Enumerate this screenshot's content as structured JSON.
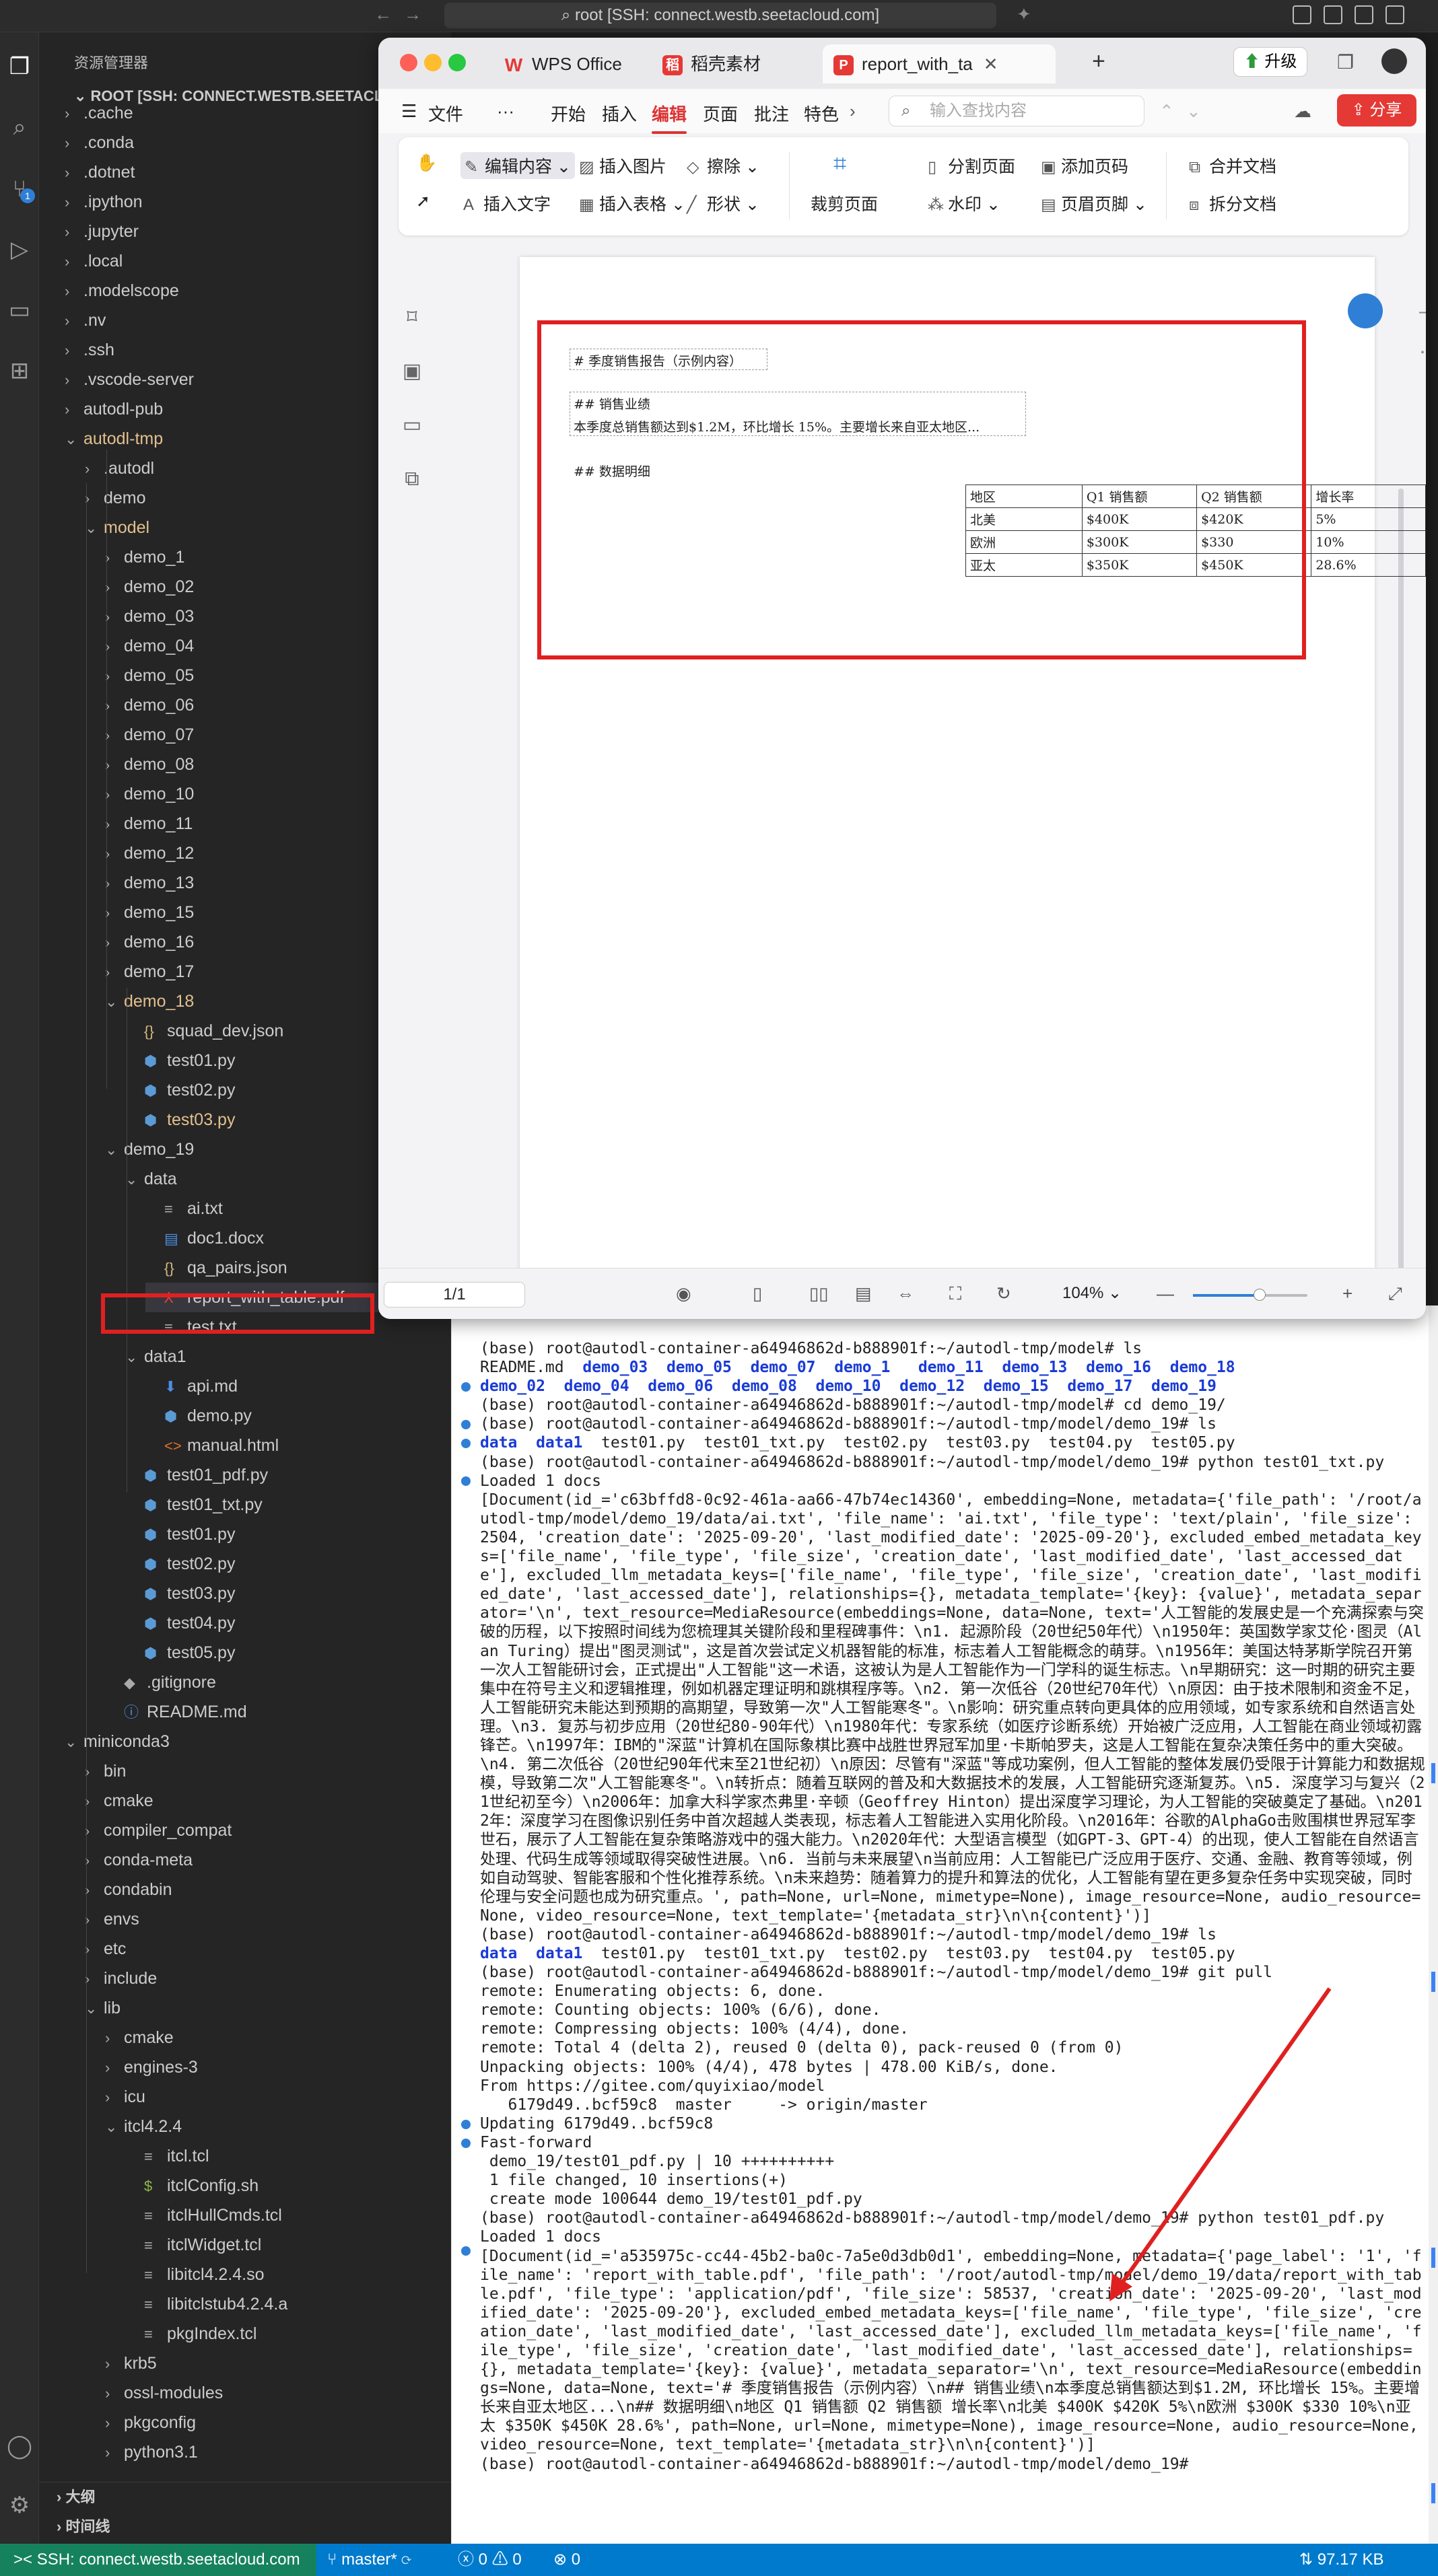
{
  "titlebar": {
    "command": "root [SSH: connect.westb.seetacloud.com]"
  },
  "activity": {
    "scm_badge": "1"
  },
  "explorer": {
    "header": "资源管理器",
    "root": "ROOT [SSH: CONNECT.WESTB.SEETACLO...",
    "items": [
      {
        "t": ".cache",
        "d": 0,
        "k": "dir-c"
      },
      {
        "t": ".conda",
        "d": 0,
        "k": "dir-c"
      },
      {
        "t": ".dotnet",
        "d": 0,
        "k": "dir-c"
      },
      {
        "t": ".ipython",
        "d": 0,
        "k": "dir-c"
      },
      {
        "t": ".jupyter",
        "d": 0,
        "k": "dir-c"
      },
      {
        "t": ".local",
        "d": 0,
        "k": "dir-c"
      },
      {
        "t": ".modelscope",
        "d": 0,
        "k": "dir-c"
      },
      {
        "t": ".nv",
        "d": 0,
        "k": "dir-c"
      },
      {
        "t": ".ssh",
        "d": 0,
        "k": "dir-c"
      },
      {
        "t": ".vscode-server",
        "d": 0,
        "k": "dir-c"
      },
      {
        "t": "autodl-pub",
        "d": 0,
        "k": "dir-c"
      },
      {
        "t": "autodl-tmp",
        "d": 0,
        "k": "dir-o",
        "y": true
      },
      {
        "t": ".autodl",
        "d": 1,
        "k": "dir-c"
      },
      {
        "t": "demo",
        "d": 1,
        "k": "dir-c"
      },
      {
        "t": "model",
        "d": 1,
        "k": "dir-o",
        "y": true
      },
      {
        "t": "demo_1",
        "d": 2,
        "k": "dir-c"
      },
      {
        "t": "demo_02",
        "d": 2,
        "k": "dir-c"
      },
      {
        "t": "demo_03",
        "d": 2,
        "k": "dir-c"
      },
      {
        "t": "demo_04",
        "d": 2,
        "k": "dir-c"
      },
      {
        "t": "demo_05",
        "d": 2,
        "k": "dir-c"
      },
      {
        "t": "demo_06",
        "d": 2,
        "k": "dir-c"
      },
      {
        "t": "demo_07",
        "d": 2,
        "k": "dir-c"
      },
      {
        "t": "demo_08",
        "d": 2,
        "k": "dir-c"
      },
      {
        "t": "demo_10",
        "d": 2,
        "k": "dir-c"
      },
      {
        "t": "demo_11",
        "d": 2,
        "k": "dir-c"
      },
      {
        "t": "demo_12",
        "d": 2,
        "k": "dir-c"
      },
      {
        "t": "demo_13",
        "d": 2,
        "k": "dir-c"
      },
      {
        "t": "demo_15",
        "d": 2,
        "k": "dir-c"
      },
      {
        "t": "demo_16",
        "d": 2,
        "k": "dir-c"
      },
      {
        "t": "demo_17",
        "d": 2,
        "k": "dir-c"
      },
      {
        "t": "demo_18",
        "d": 2,
        "k": "dir-o",
        "y": true
      },
      {
        "t": "squad_dev.json",
        "d": 3,
        "k": "json"
      },
      {
        "t": "test01.py",
        "d": 3,
        "k": "py"
      },
      {
        "t": "test02.py",
        "d": 3,
        "k": "py"
      },
      {
        "t": "test03.py",
        "d": 3,
        "k": "py",
        "y": true
      },
      {
        "t": "demo_19",
        "d": 2,
        "k": "dir-o"
      },
      {
        "t": "data",
        "d": 3,
        "k": "dir-o"
      },
      {
        "t": "ai.txt",
        "d": 4,
        "k": "txt"
      },
      {
        "t": "doc1.docx",
        "d": 4,
        "k": "doc"
      },
      {
        "t": "qa_pairs.json",
        "d": 4,
        "k": "json"
      },
      {
        "t": "report_with_table.pdf",
        "d": 4,
        "k": "pdf",
        "sel": true
      },
      {
        "t": "test.txt",
        "d": 4,
        "k": "txt"
      },
      {
        "t": "data1",
        "d": 3,
        "k": "dir-o"
      },
      {
        "t": "api.md",
        "d": 4,
        "k": "md"
      },
      {
        "t": "demo.py",
        "d": 4,
        "k": "py"
      },
      {
        "t": "manual.html",
        "d": 4,
        "k": "html"
      },
      {
        "t": "test01_pdf.py",
        "d": 3,
        "k": "py"
      },
      {
        "t": "test01_txt.py",
        "d": 3,
        "k": "py"
      },
      {
        "t": "test01.py",
        "d": 3,
        "k": "py"
      },
      {
        "t": "test02.py",
        "d": 3,
        "k": "py"
      },
      {
        "t": "test03.py",
        "d": 3,
        "k": "py"
      },
      {
        "t": "test04.py",
        "d": 3,
        "k": "py"
      },
      {
        "t": "test05.py",
        "d": 3,
        "k": "py"
      },
      {
        "t": ".gitignore",
        "d": 2,
        "k": "git"
      },
      {
        "t": "README.md",
        "d": 2,
        "k": "info"
      },
      {
        "t": "miniconda3",
        "d": 0,
        "k": "dir-o"
      },
      {
        "t": "bin",
        "d": 1,
        "k": "dir-c"
      },
      {
        "t": "cmake",
        "d": 1,
        "k": "dir-c"
      },
      {
        "t": "compiler_compat",
        "d": 1,
        "k": "dir-c"
      },
      {
        "t": "conda-meta",
        "d": 1,
        "k": "dir-c"
      },
      {
        "t": "condabin",
        "d": 1,
        "k": "dir-c"
      },
      {
        "t": "envs",
        "d": 1,
        "k": "dir-c"
      },
      {
        "t": "etc",
        "d": 1,
        "k": "dir-c"
      },
      {
        "t": "include",
        "d": 1,
        "k": "dir-c"
      },
      {
        "t": "lib",
        "d": 1,
        "k": "dir-o"
      },
      {
        "t": "cmake",
        "d": 2,
        "k": "dir-c"
      },
      {
        "t": "engines-3",
        "d": 2,
        "k": "dir-c"
      },
      {
        "t": "icu",
        "d": 2,
        "k": "dir-c"
      },
      {
        "t": "itcl4.2.4",
        "d": 2,
        "k": "dir-o"
      },
      {
        "t": "itcl.tcl",
        "d": 3,
        "k": "plain"
      },
      {
        "t": "itclConfig.sh",
        "d": 3,
        "k": "sh"
      },
      {
        "t": "itclHullCmds.tcl",
        "d": 3,
        "k": "plain"
      },
      {
        "t": "itclWidget.tcl",
        "d": 3,
        "k": "plain"
      },
      {
        "t": "libitcl4.2.4.so",
        "d": 3,
        "k": "plain"
      },
      {
        "t": "libitclstub4.2.4.a",
        "d": 3,
        "k": "plain"
      },
      {
        "t": "pkgIndex.tcl",
        "d": 3,
        "k": "plain"
      },
      {
        "t": "krb5",
        "d": 2,
        "k": "dir-c"
      },
      {
        "t": "ossl-modules",
        "d": 2,
        "k": "dir-c"
      },
      {
        "t": "pkgconfig",
        "d": 2,
        "k": "dir-c"
      },
      {
        "t": "python3.1",
        "d": 2,
        "k": "dir-c"
      }
    ]
  },
  "outline": {
    "outline": "大纲",
    "timeline": "时间线"
  },
  "status": {
    "remote": "SSH: connect.westb.seetacloud.com",
    "branch": "master*",
    "errors": "0",
    "warnings": "0",
    "ports": "0",
    "net": "97.17 KB"
  },
  "wps": {
    "tabs": [
      "WPS Office",
      "稻壳素材",
      "report_with_ta"
    ],
    "upgrade": "升级",
    "share": "分享",
    "menu": [
      "文件",
      "···",
      "开始",
      "插入",
      "编辑",
      "页面",
      "批注",
      "特色"
    ],
    "search_placeholder": "输入查找内容",
    "ribbon": {
      "edit_content": "编辑内容",
      "insert_image": "插入图片",
      "erase": "擦除",
      "insert_text": "插入文字",
      "insert_table": "插入表格",
      "shape": "形状",
      "crop_page": "裁剪页面",
      "split_page": "分割页面",
      "watermark": "水印",
      "add_page_no": "添加页码",
      "header_footer": "页眉页脚",
      "merge_doc": "合并文档",
      "split_doc": "拆分文档"
    },
    "page_indicator": "1/1",
    "zoom": "104%"
  },
  "pdf": {
    "h1": "# 季度销售报告（示例内容）",
    "h2a": "## 销售业绩",
    "p1": "本季度总销售额达到$1.2M，环比增长 15%。主要增长来自亚太地区...",
    "h2b": "## 数据明细",
    "table": [
      [
        "地区",
        "Q1 销售额",
        "Q2 销售额",
        "增长率"
      ],
      [
        "北美",
        "$400K",
        "$420K",
        "5%"
      ],
      [
        "欧洲",
        "$300K",
        "$330",
        "10%"
      ],
      [
        "亚太",
        "$350K",
        "$450K",
        "28.6%"
      ]
    ]
  },
  "terminal": {
    "lines": [
      {
        "p": "",
        "t": "(base) root@autodl-container-a64946862d-b888901f:~/autodl-tmp/model# ls"
      },
      {
        "p": "",
        "t": "README.md  ",
        "b": "demo_03  demo_05  demo_07  demo_1   demo_11  demo_13  demo_16  demo_18"
      },
      {
        "p": "",
        "b": "demo_02  demo_04  demo_06  demo_08  demo_10  demo_12  demo_15  demo_17  demo_19"
      },
      {
        "p": "",
        "t": "(base) root@autodl-container-a64946862d-b888901f:~/autodl-tmp/model# cd demo_19/"
      },
      {
        "p": "",
        "t": "(base) root@autodl-container-a64946862d-b888901f:~/autodl-tmp/model/demo_19# ls"
      },
      {
        "p": "",
        "b": "data  data1",
        "t2": "  test01.py  test01_txt.py  test02.py  test03.py  test04.py  test05.py"
      },
      {
        "p": "",
        "t": "(base) root@autodl-container-a64946862d-b888901f:~/autodl-tmp/model/demo_19# python test01_txt.py"
      },
      {
        "p": "",
        "t": "Loaded 1 docs"
      },
      {
        "p": "",
        "t": "[Document(id_='c63bffd8-0c92-461a-aa66-47b74ec14360', embedding=None, metadata={'file_path': '/root/autodl-tmp/model/demo_19/data/ai.txt', 'file_name': 'ai.txt', 'file_type': 'text/plain', 'file_size': 2504, 'creation_date': '2025-09-20', 'last_modified_date': '2025-09-20'}, excluded_embed_metadata_keys=['file_name', 'file_type', 'file_size', 'creation_date', 'last_modified_date', 'last_accessed_date'], excluded_llm_metadata_keys=['file_name', 'file_type', 'file_size', 'creation_date', 'last_modified_date', 'last_accessed_date'], relationships={}, metadata_template='{key}: {value}', metadata_separator='\\n', text_resource=MediaResource(embeddings=None, data=None, text='人工智能的发展史是一个充满探索与突破的历程，以下按照时间线为您梳理其关键阶段和里程碑事件：\\n1. 起源阶段（20世纪50年代）\\n1950年：英国数学家艾伦·图灵（Alan Turing）提出\"图灵测试\"，这是首次尝试定义机器智能的标准，标志着人工智能概念的萌芽。\\n1956年：美国达特茅斯学院召开第一次人工智能研讨会，正式提出\"人工智能\"这一术语，这被认为是人工智能作为一门学科的诞生标志。\\n早期研究：这一时期的研究主要集中在符号主义和逻辑推理，例如机器定理证明和跳棋程序等。\\n2. 第一次低谷（20世纪70年代）\\n原因：由于技术限制和资金不足，人工智能研究未能达到预期的高期望，导致第一次\"人工智能寒冬\"。\\n影响：研究重点转向更具体的应用领域，如专家系统和自然语言处理。\\n3. 复苏与初步应用（20世纪80-90年代）\\n1980年代：专家系统（如医疗诊断系统）开始被广泛应用，人工智能在商业领域初露锋芒。\\n1997年：IBM的\"深蓝\"计算机在国际象棋比赛中战胜世界冠军加里·卡斯帕罗夫，这是人工智能在复杂决策任务中的重大突破。\\n4. 第二次低谷（20世纪90年代末至21世纪初）\\n原因：尽管有\"深蓝\"等成功案例，但人工智能的整体发展仍受限于计算能力和数据规模，导致第二次\"人工智能寒冬\"。\\n转折点：随着互联网的普及和大数据技术的发展，人工智能研究逐渐复苏。\\n5. 深度学习与复兴（21世纪初至今）\\n2006年：加拿大科学家杰弗里·辛顿（Geoffrey Hinton）提出深度学习理论，为人工智能的突破奠定了基础。\\n2012年：深度学习在图像识别任务中首次超越人类表现，标志着人工智能进入实用化阶段。\\n2016年：谷歌的AlphaGo击败围棋世界冠军李世石，展示了人工智能在复杂策略游戏中的强大能力。\\n2020年代：大型语言模型（如GPT-3、GPT-4）的出现，使人工智能在自然语言处理、代码生成等领域取得突破性进展。\\n6. 当前与未来展望\\n当前应用：人工智能已广泛应用于医疗、交通、金融、教育等领域，例如自动驾驶、智能客服和个性化推荐系统。\\n未来趋势：随着算力的提升和算法的优化，人工智能有望在更多复杂任务中实现突破，同时伦理与安全问题也成为研究重点。', path=None, url=None, mimetype=None), image_resource=None, audio_resource=None, video_resource=None, text_template='{metadata_str}\\n\\n{content}')]"
      },
      {
        "p": "",
        "t": "(base) root@autodl-container-a64946862d-b888901f:~/autodl-tmp/model/demo_19# ls"
      },
      {
        "p": "",
        "b": "data  data1",
        "t2": "  test01.py  test01_txt.py  test02.py  test03.py  test04.py  test05.py"
      },
      {
        "p": "",
        "t": "(base) root@autodl-container-a64946862d-b888901f:~/autodl-tmp/model/demo_19# git pull"
      },
      {
        "p": "",
        "t": "remote: Enumerating objects: 6, done."
      },
      {
        "p": "",
        "t": "remote: Counting objects: 100% (6/6), done."
      },
      {
        "p": "",
        "t": "remote: Compressing objects: 100% (4/4), done."
      },
      {
        "p": "",
        "t": "remote: Total 4 (delta 2), reused 0 (delta 0), pack-reused 0 (from 0)"
      },
      {
        "p": "",
        "t": "Unpacking objects: 100% (4/4), 478 bytes | 478.00 KiB/s, done."
      },
      {
        "p": "",
        "t": "From https://gitee.com/quyixiao/model"
      },
      {
        "p": "",
        "t": "   6179d49..bcf59c8  master     -> origin/master"
      },
      {
        "p": "",
        "t": "Updating 6179d49..bcf59c8"
      },
      {
        "p": "",
        "t": "Fast-forward"
      },
      {
        "p": "",
        "t": " demo_19/test01_pdf.py | 10 ++++++++++"
      },
      {
        "p": "",
        "t": " 1 file changed, 10 insertions(+)"
      },
      {
        "p": "",
        "t": " create mode 100644 demo_19/test01_pdf.py"
      },
      {
        "p": "",
        "t": "(base) root@autodl-container-a64946862d-b888901f:~/autodl-tmp/model/demo_19# python test01_pdf.py"
      },
      {
        "p": "",
        "t": "Loaded 1 docs"
      },
      {
        "p": "",
        "t": "[Document(id_='a535975c-cc44-45b2-ba0c-7a5e0d3db0d1', embedding=None, metadata={'page_label': '1', 'file_name': 'report_with_table.pdf', 'file_path': '/root/autodl-tmp/model/demo_19/data/report_with_table.pdf', 'file_type': 'application/pdf', 'file_size': 58537, 'creation_date': '2025-09-20', 'last_modified_date': '2025-09-20'}, excluded_embed_metadata_keys=['file_name', 'file_type', 'file_size', 'creation_date', 'last_modified_date', 'last_accessed_date'], excluded_llm_metadata_keys=['file_name', 'file_type', 'file_size', 'creation_date', 'last_modified_date', 'last_accessed_date'], relationships={}, metadata_template='{key}: {value}', metadata_separator='\\n', text_resource=MediaResource(embeddings=None, data=None, text='# 季度销售报告（示例内容）\\n## 销售业绩\\n本季度总销售额达到$1.2M, 环比增长 15%。主要增长来自亚太地区...\\n## 数据明细\\n地区 Q1 销售额 Q2 销售额 增长率\\n北美 $400K $420K 5%\\n欧洲 $300K $330 10%\\n亚太 $350K $450K 28.6%', path=None, url=None, mimetype=None), image_resource=None, audio_resource=None, video_resource=None, text_template='{metadata_str}\\n\\n{content}')]"
      },
      {
        "p": "",
        "t": "(base) root@autodl-container-a64946862d-b888901f:~/autodl-tmp/model/demo_19# "
      }
    ]
  }
}
